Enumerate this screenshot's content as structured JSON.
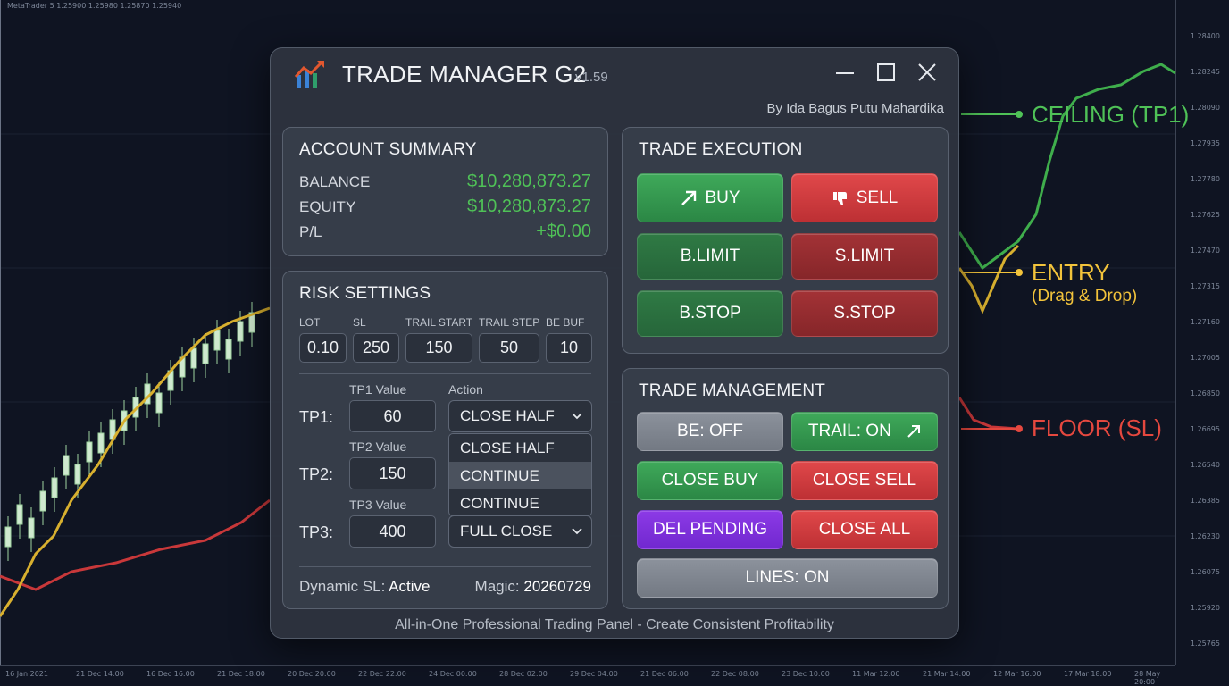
{
  "chart": {
    "top_strip": "MetaTrader 5 1.25900 1.25980 1.25870 1.25940",
    "price_ticks": [
      "1.28400",
      "1.28245",
      "1.28090",
      "1.27935",
      "1.27780",
      "1.27625",
      "1.27470",
      "1.27315",
      "1.27160",
      "1.27005",
      "1.26850",
      "1.26695",
      "1.26540",
      "1.26385",
      "1.26230",
      "1.26075",
      "1.25920",
      "1.25765"
    ],
    "time_ticks": [
      "16 Jan 2021",
      "21 Dec 14:00",
      "16 Dec 16:00",
      "21 Dec 18:00",
      "20 Dec 20:00",
      "22 Dec 22:00",
      "24 Dec 00:00",
      "28 Dec 02:00",
      "29 Dec 04:00",
      "21 Dec 06:00",
      "22 Dec 08:00",
      "23 Dec 10:00",
      "11 Mar 12:00",
      "21 Mar 14:00",
      "12 Mar 16:00",
      "17 Mar 18:00",
      "28 May 20:00"
    ],
    "levels": {
      "ceiling": "CEILING (TP1)",
      "entry": "ENTRY",
      "entry_sub": "(Drag & Drop)",
      "floor": "FLOOR (SL)"
    },
    "colors": {
      "ceiling": "#4fc257",
      "entry": "#f2c33b",
      "floor": "#e5483f"
    }
  },
  "window": {
    "title": "TRADE MANAGER G2",
    "version": "v1.59",
    "author": "By Ida Bagus Putu Mahardika",
    "tagline": "All-in-One Professional Trading Panel - Create Consistent Profitability"
  },
  "account": {
    "title": "ACCOUNT SUMMARY",
    "rows": [
      {
        "label": "BALANCE",
        "value": "$10,280,873.27"
      },
      {
        "label": "EQUITY",
        "value": "$10,280,873.27"
      },
      {
        "label": "P/L",
        "value": "+$0.00"
      }
    ]
  },
  "risk": {
    "title": "RISK SETTINGS",
    "fields": [
      {
        "label": "LOT",
        "value": "0.10"
      },
      {
        "label": "SL",
        "value": "250"
      },
      {
        "label": "TRAIL START",
        "value": "150"
      },
      {
        "label": "TRAIL STEP",
        "value": "50"
      },
      {
        "label": "BE BUF",
        "value": "10"
      }
    ],
    "action_header": "Action",
    "tps": [
      {
        "label": "TP1:",
        "value_label": "TP1 Value",
        "value": "60",
        "action": "CLOSE HALF"
      },
      {
        "label": "TP2:",
        "value_label": "TP2 Value",
        "value": "150"
      },
      {
        "label": "TP3:",
        "value_label": "TP3 Value",
        "value": "400",
        "action": "FULL CLOSE"
      }
    ],
    "dropdown_options": [
      "CLOSE HALF",
      "CONTINUE",
      "CONTINUE"
    ],
    "dynamic_sl_label": "Dynamic SL:",
    "dynamic_sl_value": "Active",
    "magic_label": "Magic:",
    "magic_value": "20260729"
  },
  "execution": {
    "title": "TRADE EXECUTION",
    "buy": "BUY",
    "sell": "SELL",
    "buy_limit": "B.LIMIT",
    "sell_limit": "S.LIMIT",
    "buy_stop": "B.STOP",
    "sell_stop": "S.STOP"
  },
  "management": {
    "title": "TRADE MANAGEMENT",
    "be": "BE: OFF",
    "trail": "TRAIL: ON",
    "close_buy": "CLOSE BUY",
    "close_sell": "CLOSE SELL",
    "del_pending": "DEL PENDING",
    "close_all": "CLOSE ALL",
    "lines": "LINES: ON"
  }
}
